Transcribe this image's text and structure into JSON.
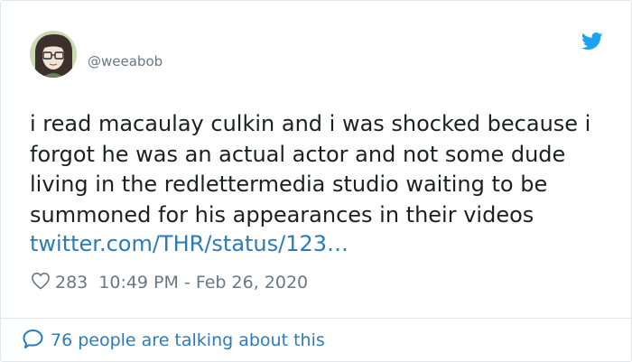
{
  "tweet": {
    "author_handle": "@weeabob",
    "text": "i read macaulay culkin and i was shocked because i\nforgot he was an actual actor and not some dude\nliving in the redlettermedia studio waiting to be\nsummoned for his appearances in their videos",
    "link": "twitter.com/THR/status/123…",
    "likes": "283",
    "timestamp": "10:49 PM - Feb 26, 2020",
    "conversation": "76 people are talking about this"
  },
  "icons": {
    "brand": "twitter-bird-icon",
    "like": "heart-icon",
    "reply": "speech-bubble-icon"
  },
  "colors": {
    "brand": "#1da1f2",
    "link": "#2b7bb9",
    "text": "#1c2022",
    "muted": "#697882",
    "border": "#e1e8ed"
  }
}
